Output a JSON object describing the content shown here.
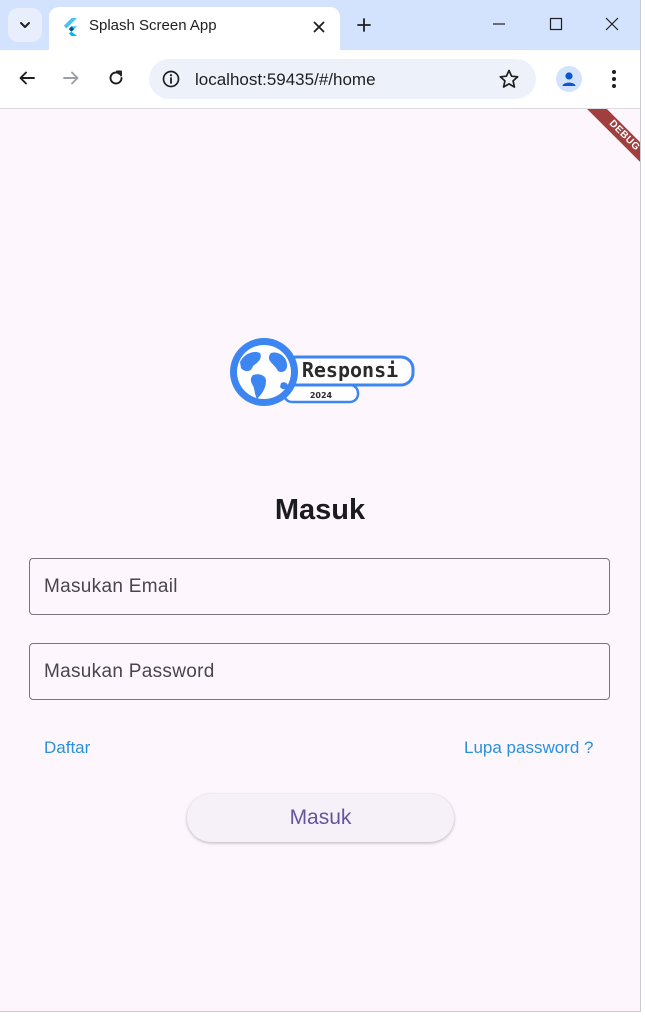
{
  "browser": {
    "tab_title": "Splash Screen App",
    "url": "localhost:59435/#/home"
  },
  "app": {
    "debug_banner": "DEBUG",
    "logo": {
      "brand_text": "Responsi",
      "year_text": "2024"
    },
    "title": "Masuk",
    "email_placeholder": "Masukan Email",
    "password_placeholder": "Masukan Password",
    "register_link": "Daftar",
    "forgot_link": "Lupa password ?",
    "login_button": "Masuk"
  },
  "colors": {
    "background": "#fdf7fd",
    "link": "#2a8fdc",
    "button_text": "#65559b",
    "logo_blue": "#3d85f0",
    "debug_banner": "#a13f3f"
  }
}
